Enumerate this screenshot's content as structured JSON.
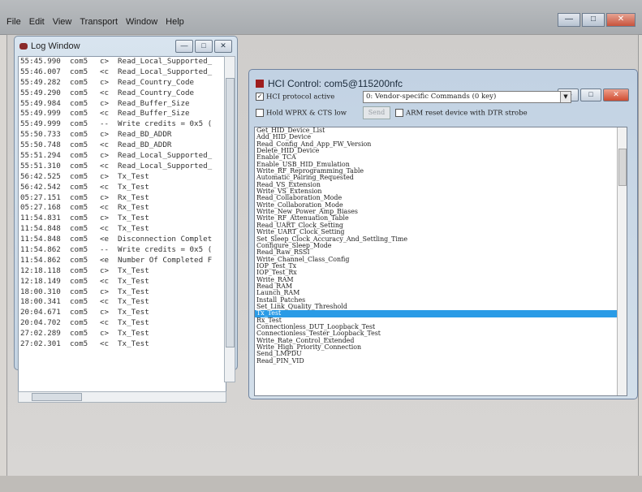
{
  "menu": [
    "File",
    "Edit",
    "View",
    "Transport",
    "Window",
    "Help"
  ],
  "log_window": {
    "title": "Log Window",
    "rows": [
      {
        "time": "55:45.990",
        "port": "com5",
        "dir": "c>",
        "msg": "Read_Local_Supported_"
      },
      {
        "time": "55:46.007",
        "port": "com5",
        "dir": "<c",
        "msg": "Read_Local_Supported_"
      },
      {
        "time": "55:49.282",
        "port": "com5",
        "dir": "c>",
        "msg": "Read_Country_Code"
      },
      {
        "time": "55:49.290",
        "port": "com5",
        "dir": "<c",
        "msg": "Read_Country_Code"
      },
      {
        "time": "55:49.984",
        "port": "com5",
        "dir": "c>",
        "msg": "Read_Buffer_Size"
      },
      {
        "time": "55:49.999",
        "port": "com5",
        "dir": "<c",
        "msg": "Read_Buffer_Size"
      },
      {
        "time": "55:49.999",
        "port": "com5",
        "dir": "--",
        "msg": "Write credits = 0x5 ("
      },
      {
        "time": "55:50.733",
        "port": "com5",
        "dir": "c>",
        "msg": "Read_BD_ADDR"
      },
      {
        "time": "55:50.748",
        "port": "com5",
        "dir": "<c",
        "msg": "Read_BD_ADDR"
      },
      {
        "time": "55:51.294",
        "port": "com5",
        "dir": "c>",
        "msg": "Read_Local_Supported_"
      },
      {
        "time": "55:51.310",
        "port": "com5",
        "dir": "<c",
        "msg": "Read_Local_Supported_"
      },
      {
        "time": "56:42.525",
        "port": "com5",
        "dir": "c>",
        "msg": "Tx_Test"
      },
      {
        "time": "56:42.542",
        "port": "com5",
        "dir": "<c",
        "msg": "Tx_Test"
      },
      {
        "time": "05:27.151",
        "port": "com5",
        "dir": "c>",
        "msg": "Rx_Test"
      },
      {
        "time": "05:27.168",
        "port": "com5",
        "dir": "<c",
        "msg": "Rx_Test"
      },
      {
        "time": "11:54.831",
        "port": "com5",
        "dir": "c>",
        "msg": "Tx_Test"
      },
      {
        "time": "11:54.848",
        "port": "com5",
        "dir": "<c",
        "msg": "Tx_Test"
      },
      {
        "time": "11:54.848",
        "port": "com5",
        "dir": "<e",
        "msg": "Disconnection Complet"
      },
      {
        "time": "11:54.862",
        "port": "com5",
        "dir": "--",
        "msg": "Write credits = 0x5 ("
      },
      {
        "time": "11:54.862",
        "port": "com5",
        "dir": "<e",
        "msg": "Number Of Completed F"
      },
      {
        "time": "12:18.118",
        "port": "com5",
        "dir": "c>",
        "msg": "Tx_Test"
      },
      {
        "time": "12:18.149",
        "port": "com5",
        "dir": "<c",
        "msg": "Tx_Test"
      },
      {
        "time": "18:00.310",
        "port": "com5",
        "dir": "c>",
        "msg": "Tx_Test"
      },
      {
        "time": "18:00.341",
        "port": "com5",
        "dir": "<c",
        "msg": "Tx_Test"
      },
      {
        "time": "20:04.671",
        "port": "com5",
        "dir": "c>",
        "msg": "Tx_Test"
      },
      {
        "time": "20:04.702",
        "port": "com5",
        "dir": "<c",
        "msg": "Tx_Test"
      },
      {
        "time": "27:02.289",
        "port": "com5",
        "dir": "c>",
        "msg": "Tx_Test"
      },
      {
        "time": "27:02.301",
        "port": "com5",
        "dir": "<c",
        "msg": "Tx_Test"
      }
    ]
  },
  "hci_window": {
    "title": "HCI Control: com5@115200nfc",
    "protocol_active_label": "HCI protocol active",
    "protocol_active_checked": "✓",
    "vendor_select_value": "0: Vendor-specific Commands (0 key)",
    "hold_label": "Hold WPRX & CTS low",
    "send_label": "Send",
    "arm_reset_label": "ARM reset device with DTR strobe",
    "commands": [
      "Get_HID_Device_List",
      "Add_HID_Device",
      "Read_Config_And_App_FW_Version",
      "Delete_HID_Device",
      "Enable_TCA",
      "Enable_USB_HID_Emulation",
      "Write_RF_Reprogramming_Table",
      "Automatic_Pairing_Requested",
      "Read_VS_Extension",
      "Write_VS_Extension",
      "Read_Collaboration_Mode",
      "Write_Collaboration_Mode",
      "Write_New_Power_Amp_Biases",
      "Write_RF_Attenuation_Table",
      "Read_UART_Clock_Setting",
      "Write_UART_Clock_Setting",
      "Set_Sleep_Clock_Accuracy_And_Settling_Time",
      "Configure_Sleep_Mode",
      "Read_Raw_RSSI",
      "Write_Channel_Class_Config",
      "IOP_Test_Tx",
      "IOP_Test_Rx",
      "Write_RAM",
      "Read_RAM",
      "Launch_RAM",
      "Install_Patches",
      "Set_Link_Quality_Threshold",
      "Tx_Test",
      "Rx_Test",
      "Connectionless_DUT_Loopback_Test",
      "Connectionless_Tester_Loopback_Test",
      "Write_Rate_Control_Extended",
      "Write_High_Priority_Connection",
      "Send_LMPDU",
      "Read_PIN_VID"
    ],
    "selected_command": "Tx_Test"
  },
  "colors": {
    "selection": "#2a9be6"
  }
}
